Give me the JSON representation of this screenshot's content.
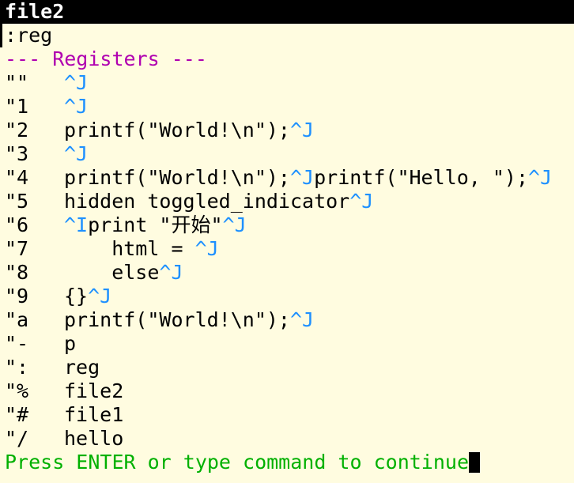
{
  "window": {
    "title": "file2"
  },
  "command_line": ":reg",
  "heading": "--- Registers ---",
  "registers": [
    {
      "name": "\"\"",
      "segments": [
        {
          "text": "^J",
          "ctrl": true
        }
      ]
    },
    {
      "name": "\"1",
      "segments": [
        {
          "text": "^J",
          "ctrl": true
        }
      ]
    },
    {
      "name": "\"2",
      "segments": [
        {
          "text": "printf(\"World!\\n\");",
          "ctrl": false
        },
        {
          "text": "^J",
          "ctrl": true
        }
      ]
    },
    {
      "name": "\"3",
      "segments": [
        {
          "text": "^J",
          "ctrl": true
        }
      ]
    },
    {
      "name": "\"4",
      "segments": [
        {
          "text": "printf(\"World!\\n\");",
          "ctrl": false
        },
        {
          "text": "^J",
          "ctrl": true
        },
        {
          "text": "printf(\"Hello, \");",
          "ctrl": false
        },
        {
          "text": "^J",
          "ctrl": true
        }
      ]
    },
    {
      "name": "\"5",
      "segments": [
        {
          "text": "hidden toggled_indicator",
          "ctrl": false
        },
        {
          "text": "^J",
          "ctrl": true
        }
      ]
    },
    {
      "name": "\"6",
      "segments": [
        {
          "text": "^I",
          "ctrl": true
        },
        {
          "text": "print \"开始\"",
          "ctrl": false
        },
        {
          "text": "^J",
          "ctrl": true
        }
      ]
    },
    {
      "name": "\"7",
      "segments": [
        {
          "text": "    html = ",
          "ctrl": false
        },
        {
          "text": "^J",
          "ctrl": true
        }
      ]
    },
    {
      "name": "\"8",
      "segments": [
        {
          "text": "    else",
          "ctrl": false
        },
        {
          "text": "^J",
          "ctrl": true
        }
      ]
    },
    {
      "name": "\"9",
      "segments": [
        {
          "text": "{}",
          "ctrl": false
        },
        {
          "text": "^J",
          "ctrl": true
        }
      ]
    },
    {
      "name": "\"a",
      "segments": [
        {
          "text": "printf(\"World!\\n\");",
          "ctrl": false
        },
        {
          "text": "^J",
          "ctrl": true
        }
      ]
    },
    {
      "name": "\"-",
      "segments": [
        {
          "text": "p",
          "ctrl": false
        }
      ]
    },
    {
      "name": "\":",
      "segments": [
        {
          "text": "reg",
          "ctrl": false
        }
      ]
    },
    {
      "name": "\"%",
      "segments": [
        {
          "text": "file2",
          "ctrl": false
        }
      ]
    },
    {
      "name": "\"#",
      "segments": [
        {
          "text": "file1",
          "ctrl": false
        }
      ]
    },
    {
      "name": "\"/",
      "segments": [
        {
          "text": "hello",
          "ctrl": false
        }
      ]
    }
  ],
  "prompt": "Press ENTER or type command to continue",
  "colors": {
    "background": "#fffce0",
    "tabline": "#000000",
    "ctrl_char": "#1e90ff",
    "heading": "#b000b0",
    "prompt": "#00b000"
  }
}
